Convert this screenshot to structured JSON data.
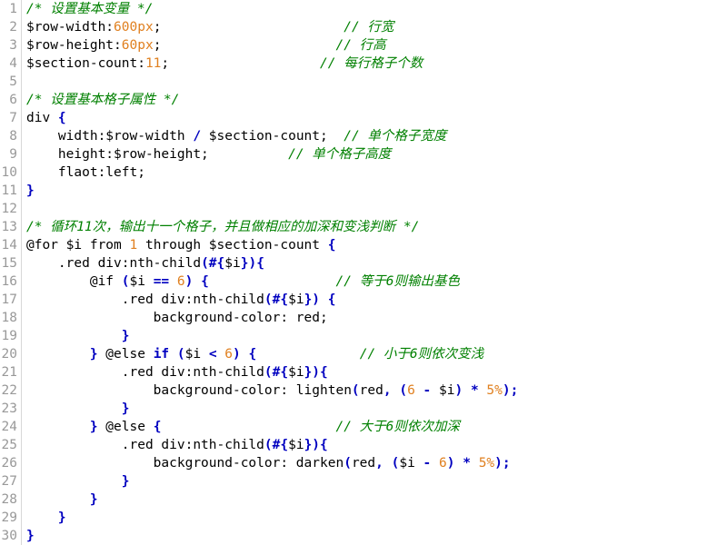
{
  "editor": {
    "language": "SCSS",
    "background_color": "#ffffff",
    "gutter_color": "#999999",
    "gutter_border_color": "#d8d8d8",
    "total_lines": 30,
    "theme_colors": {
      "plain": "#000000",
      "comment": "#008000",
      "number": "#e08020",
      "punctuation": "#0000c0",
      "keyword": "#0000c0"
    }
  },
  "lines": [
    {
      "number": "1",
      "tokens": [
        {
          "text": "/* 设置基本变量 */",
          "type": "comment"
        }
      ]
    },
    {
      "number": "2",
      "tokens": [
        {
          "text": "$row-width:",
          "type": "plain"
        },
        {
          "text": "600px",
          "type": "number"
        },
        {
          "text": ";",
          "type": "plain"
        },
        {
          "text": "                       ",
          "type": "plain"
        },
        {
          "text": "// 行宽",
          "type": "comment"
        }
      ]
    },
    {
      "number": "3",
      "tokens": [
        {
          "text": "$row-height:",
          "type": "plain"
        },
        {
          "text": "60px",
          "type": "number"
        },
        {
          "text": ";",
          "type": "plain"
        },
        {
          "text": "                      ",
          "type": "plain"
        },
        {
          "text": "// 行高",
          "type": "comment"
        }
      ]
    },
    {
      "number": "4",
      "tokens": [
        {
          "text": "$section-count:",
          "type": "plain"
        },
        {
          "text": "11",
          "type": "number"
        },
        {
          "text": ";",
          "type": "plain"
        },
        {
          "text": "                   ",
          "type": "plain"
        },
        {
          "text": "// 每行格子个数",
          "type": "comment"
        }
      ]
    },
    {
      "number": "5",
      "tokens": []
    },
    {
      "number": "6",
      "tokens": [
        {
          "text": "/* 设置基本格子属性 */",
          "type": "comment"
        }
      ]
    },
    {
      "number": "7",
      "tokens": [
        {
          "text": "div ",
          "type": "plain"
        },
        {
          "text": "{",
          "type": "punct"
        }
      ]
    },
    {
      "number": "8",
      "tokens": [
        {
          "text": "    width:$row-width ",
          "type": "plain"
        },
        {
          "text": "/",
          "type": "punct"
        },
        {
          "text": " $section-count;",
          "type": "plain"
        },
        {
          "text": "  ",
          "type": "plain"
        },
        {
          "text": "// 单个格子宽度",
          "type": "comment"
        }
      ]
    },
    {
      "number": "9",
      "tokens": [
        {
          "text": "    height:$row-height;",
          "type": "plain"
        },
        {
          "text": "          ",
          "type": "plain"
        },
        {
          "text": "// 单个格子高度",
          "type": "comment"
        }
      ]
    },
    {
      "number": "10",
      "tokens": [
        {
          "text": "    flaot:left;",
          "type": "plain"
        }
      ]
    },
    {
      "number": "11",
      "tokens": [
        {
          "text": "}",
          "type": "punct"
        }
      ]
    },
    {
      "number": "12",
      "tokens": []
    },
    {
      "number": "13",
      "tokens": [
        {
          "text": "/* 循环11次，输出十一个格子，并且做相应的加深和变浅判断 */",
          "type": "comment"
        }
      ]
    },
    {
      "number": "14",
      "tokens": [
        {
          "text": "@for $i from ",
          "type": "plain"
        },
        {
          "text": "1",
          "type": "number"
        },
        {
          "text": " through $section-count ",
          "type": "plain"
        },
        {
          "text": "{",
          "type": "punct"
        }
      ]
    },
    {
      "number": "15",
      "tokens": [
        {
          "text": "    .red div:nth-child",
          "type": "plain"
        },
        {
          "text": "(#{",
          "type": "punct"
        },
        {
          "text": "$i",
          "type": "plain"
        },
        {
          "text": "}){",
          "type": "punct"
        }
      ]
    },
    {
      "number": "16",
      "tokens": [
        {
          "text": "        @if ",
          "type": "plain"
        },
        {
          "text": "(",
          "type": "punct"
        },
        {
          "text": "$i ",
          "type": "plain"
        },
        {
          "text": "==",
          "type": "punct"
        },
        {
          "text": " ",
          "type": "plain"
        },
        {
          "text": "6",
          "type": "number"
        },
        {
          "text": ") {",
          "type": "punct"
        },
        {
          "text": "                ",
          "type": "plain"
        },
        {
          "text": "// 等于6则输出基色",
          "type": "comment"
        }
      ]
    },
    {
      "number": "17",
      "tokens": [
        {
          "text": "            .red div:nth-child",
          "type": "plain"
        },
        {
          "text": "(#{",
          "type": "punct"
        },
        {
          "text": "$i",
          "type": "plain"
        },
        {
          "text": "})",
          "type": "punct"
        },
        {
          "text": " ",
          "type": "plain"
        },
        {
          "text": "{",
          "type": "punct"
        }
      ]
    },
    {
      "number": "18",
      "tokens": [
        {
          "text": "                background-color: red;",
          "type": "plain"
        }
      ]
    },
    {
      "number": "19",
      "tokens": [
        {
          "text": "            ",
          "type": "plain"
        },
        {
          "text": "}",
          "type": "punct"
        }
      ]
    },
    {
      "number": "20",
      "tokens": [
        {
          "text": "        ",
          "type": "plain"
        },
        {
          "text": "}",
          "type": "punct"
        },
        {
          "text": " @else ",
          "type": "plain"
        },
        {
          "text": "if",
          "type": "keyword"
        },
        {
          "text": " ",
          "type": "plain"
        },
        {
          "text": "(",
          "type": "punct"
        },
        {
          "text": "$i ",
          "type": "plain"
        },
        {
          "text": "<",
          "type": "punct"
        },
        {
          "text": " ",
          "type": "plain"
        },
        {
          "text": "6",
          "type": "number"
        },
        {
          "text": ") {",
          "type": "punct"
        },
        {
          "text": "             ",
          "type": "plain"
        },
        {
          "text": "// 小于6则依次变浅",
          "type": "comment"
        }
      ]
    },
    {
      "number": "21",
      "tokens": [
        {
          "text": "            .red div:nth-child",
          "type": "plain"
        },
        {
          "text": "(#{",
          "type": "punct"
        },
        {
          "text": "$i",
          "type": "plain"
        },
        {
          "text": "}){",
          "type": "punct"
        }
      ]
    },
    {
      "number": "22",
      "tokens": [
        {
          "text": "                background-color: lighten",
          "type": "plain"
        },
        {
          "text": "(",
          "type": "punct"
        },
        {
          "text": "red",
          "type": "plain"
        },
        {
          "text": ",",
          "type": "punct"
        },
        {
          "text": " ",
          "type": "plain"
        },
        {
          "text": "(",
          "type": "punct"
        },
        {
          "text": "6",
          "type": "number"
        },
        {
          "text": " ",
          "type": "plain"
        },
        {
          "text": "-",
          "type": "punct"
        },
        {
          "text": " $i",
          "type": "plain"
        },
        {
          "text": ")",
          "type": "punct"
        },
        {
          "text": " ",
          "type": "plain"
        },
        {
          "text": "*",
          "type": "punct"
        },
        {
          "text": " ",
          "type": "plain"
        },
        {
          "text": "5%",
          "type": "number"
        },
        {
          "text": ");",
          "type": "punct"
        }
      ]
    },
    {
      "number": "23",
      "tokens": [
        {
          "text": "            ",
          "type": "plain"
        },
        {
          "text": "}",
          "type": "punct"
        }
      ]
    },
    {
      "number": "24",
      "tokens": [
        {
          "text": "        ",
          "type": "plain"
        },
        {
          "text": "}",
          "type": "punct"
        },
        {
          "text": " @else ",
          "type": "plain"
        },
        {
          "text": "{",
          "type": "punct"
        },
        {
          "text": "                      ",
          "type": "plain"
        },
        {
          "text": "// 大于6则依次加深",
          "type": "comment"
        }
      ]
    },
    {
      "number": "25",
      "tokens": [
        {
          "text": "            .red div:nth-child",
          "type": "plain"
        },
        {
          "text": "(#{",
          "type": "punct"
        },
        {
          "text": "$i",
          "type": "plain"
        },
        {
          "text": "}){",
          "type": "punct"
        }
      ]
    },
    {
      "number": "26",
      "tokens": [
        {
          "text": "                background-color: darken",
          "type": "plain"
        },
        {
          "text": "(",
          "type": "punct"
        },
        {
          "text": "red",
          "type": "plain"
        },
        {
          "text": ",",
          "type": "punct"
        },
        {
          "text": " ",
          "type": "plain"
        },
        {
          "text": "(",
          "type": "punct"
        },
        {
          "text": "$i",
          "type": "plain"
        },
        {
          "text": " ",
          "type": "plain"
        },
        {
          "text": "-",
          "type": "punct"
        },
        {
          "text": " ",
          "type": "plain"
        },
        {
          "text": "6",
          "type": "number"
        },
        {
          "text": ")",
          "type": "punct"
        },
        {
          "text": " ",
          "type": "plain"
        },
        {
          "text": "*",
          "type": "punct"
        },
        {
          "text": " ",
          "type": "plain"
        },
        {
          "text": "5%",
          "type": "number"
        },
        {
          "text": ");",
          "type": "punct"
        }
      ]
    },
    {
      "number": "27",
      "tokens": [
        {
          "text": "            ",
          "type": "plain"
        },
        {
          "text": "}",
          "type": "punct"
        }
      ]
    },
    {
      "number": "28",
      "tokens": [
        {
          "text": "        ",
          "type": "plain"
        },
        {
          "text": "}",
          "type": "punct"
        }
      ]
    },
    {
      "number": "29",
      "tokens": [
        {
          "text": "    ",
          "type": "plain"
        },
        {
          "text": "}",
          "type": "punct"
        }
      ]
    },
    {
      "number": "30",
      "tokens": [
        {
          "text": "}",
          "type": "punct"
        }
      ]
    }
  ]
}
